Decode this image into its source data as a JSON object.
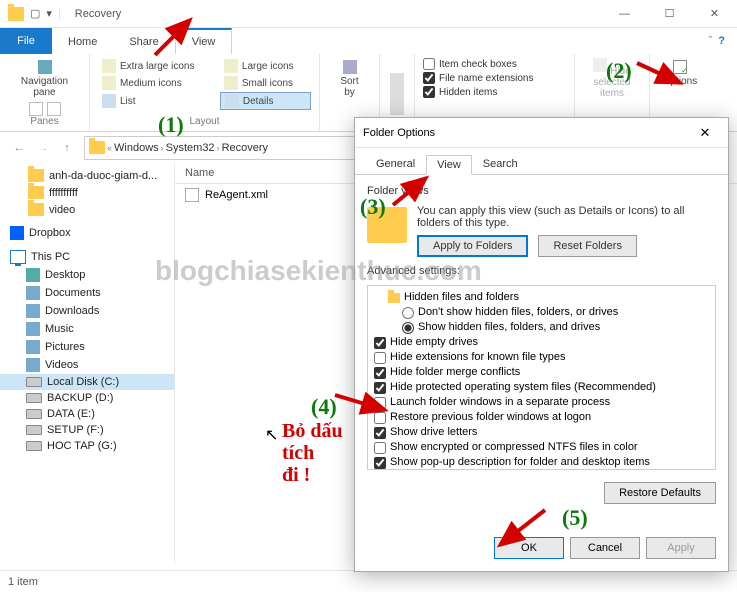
{
  "titlebar": {
    "title": "Recovery"
  },
  "tabs": {
    "file": "File",
    "home": "Home",
    "share": "Share",
    "view": "View"
  },
  "ribbon": {
    "nav_pane": "Navigation\npane",
    "panes": "Panes",
    "layout_items": [
      "Extra large icons",
      "Large icons",
      "Medium icons",
      "Small icons",
      "List",
      "Details"
    ],
    "layout": "Layout",
    "sort_by": "Sort\nby",
    "item_checkboxes": "Item check boxes",
    "file_ext": "File name extensions",
    "hidden_items": "Hidden items",
    "hide_selected": "Hide selected\nitems",
    "options": "Options"
  },
  "address": {
    "c0": "Windows",
    "c1": "System32",
    "c2": "Recovery"
  },
  "tree": {
    "items": [
      {
        "label": "anh-da-duoc-giam-d...",
        "type": "folder"
      },
      {
        "label": "ffffffffff",
        "type": "folder"
      },
      {
        "label": "video",
        "type": "folder"
      }
    ],
    "dropbox": "Dropbox",
    "this_pc": "This PC",
    "pc_items": [
      "Desktop",
      "Documents",
      "Downloads",
      "Music",
      "Pictures",
      "Videos",
      "Local Disk (C:)",
      "BACKUP (D:)",
      "DATA (E:)",
      "SETUP (F:)",
      "HOC TAP (G:)"
    ]
  },
  "list": {
    "header_name": "Name",
    "file0": "ReAgent.xml"
  },
  "statusbar": {
    "text": "1 item"
  },
  "dialog": {
    "title": "Folder Options",
    "tabs": {
      "general": "General",
      "view": "View",
      "search": "Search"
    },
    "folder_views_label": "Folder views",
    "folder_views_text": "You can apply this view (such as Details or Icons) to all folders of this type.",
    "apply_to_folders": "Apply to Folders",
    "reset_folders": "Reset Folders",
    "advanced_label": "Advanced settings:",
    "adv": {
      "hidden_group": "Hidden files and folders",
      "dont_show": "Don't show hidden files, folders, or drives",
      "show_hidden": "Show hidden files, folders, and drives",
      "hide_empty": "Hide empty drives",
      "hide_ext": "Hide extensions for known file types",
      "hide_merge": "Hide folder merge conflicts",
      "hide_protected": "Hide protected operating system files (Recommended)",
      "launch_sep": "Launch folder windows in a separate process",
      "restore_prev": "Restore previous folder windows at logon",
      "show_drive": "Show drive letters",
      "show_enc": "Show encrypted or compressed NTFS files in color",
      "show_popup": "Show pop-up description for folder and desktop items"
    },
    "restore_defaults": "Restore Defaults",
    "ok": "OK",
    "cancel": "Cancel",
    "apply": "Apply"
  },
  "watermark": "blogchiasekienthuc.com",
  "annotations": {
    "a1": "(1)",
    "a2": "(2)",
    "a3": "(3)",
    "a4": "(4)",
    "a5": "(5)",
    "red_text": "Bỏ dấu\ntích\nđi !"
  }
}
